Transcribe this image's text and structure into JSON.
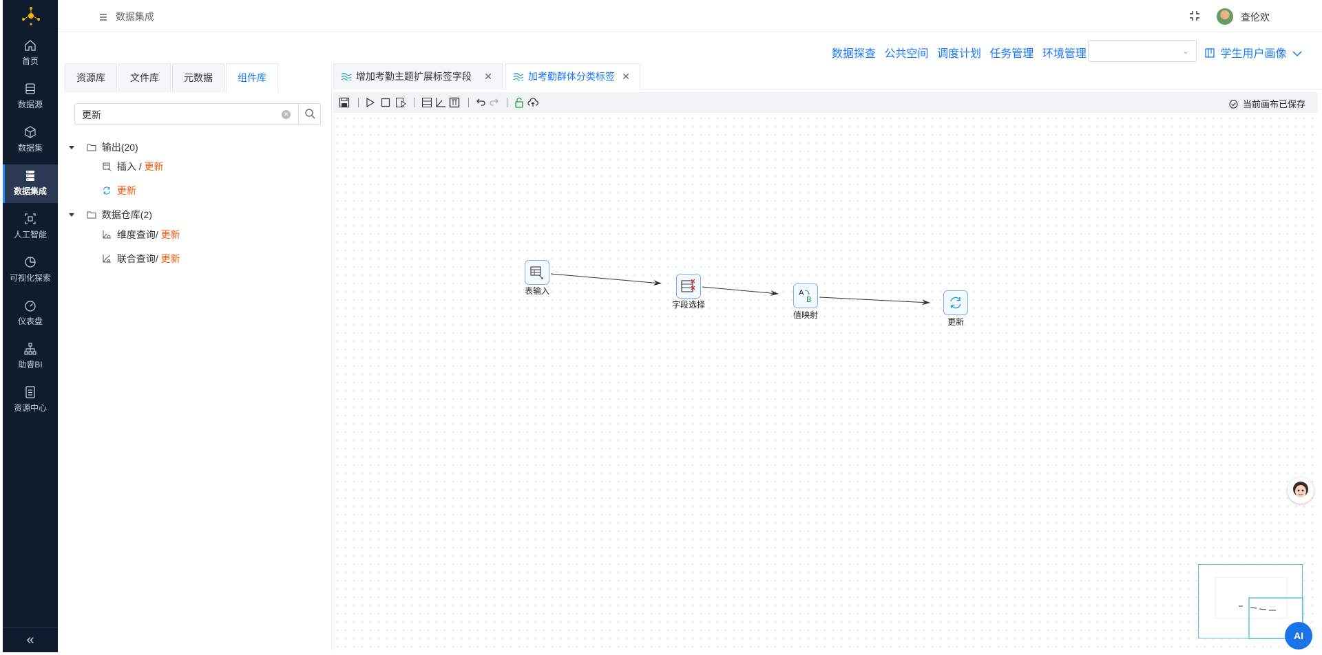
{
  "sidebar": {
    "items": [
      {
        "label": "首页",
        "icon": "home-icon"
      },
      {
        "label": "数据源",
        "icon": "database-icon"
      },
      {
        "label": "数据集",
        "icon": "cube-icon"
      },
      {
        "label": "数据集成",
        "icon": "server-icon",
        "active": true
      },
      {
        "label": "人工智能",
        "icon": "ai-scan-icon"
      },
      {
        "label": "可视化探索",
        "icon": "pie-chart-icon"
      },
      {
        "label": "仪表盘",
        "icon": "gauge-icon"
      },
      {
        "label": "助睿BI",
        "icon": "org-chart-icon"
      },
      {
        "label": "资源中心",
        "icon": "resource-icon"
      }
    ],
    "collapse_label": "«"
  },
  "header": {
    "breadcrumb": "数据集成",
    "username": "查伦欢"
  },
  "toplinks": [
    "数据探查",
    "公共空间",
    "调度计划",
    "任务管理",
    "环境管理"
  ],
  "env_select": {
    "value": ""
  },
  "project": {
    "name": "学生用户画像"
  },
  "left_panel": {
    "tabs": [
      {
        "label": "资源库"
      },
      {
        "label": "文件库"
      },
      {
        "label": "元数据"
      },
      {
        "label": "组件库",
        "active": true
      }
    ],
    "search": {
      "value": "更新"
    },
    "tree": {
      "group1": {
        "label": "输出(20)",
        "items": [
          {
            "prefix": "插入 / ",
            "highlight": "更新"
          },
          {
            "prefix": "",
            "highlight": "更新"
          }
        ]
      },
      "group2": {
        "label": "数据仓库(2)",
        "items": [
          {
            "prefix": "维度查询/ ",
            "highlight": "更新"
          },
          {
            "prefix": "联合查询/ ",
            "highlight": "更新"
          }
        ]
      }
    }
  },
  "canvas": {
    "tabs": [
      {
        "label": "增加考勤主题扩展标签字段"
      },
      {
        "label": "加考勤群体分类标签",
        "active": true
      }
    ],
    "status": "当前画布已保存",
    "nodes": [
      {
        "label": "表输入"
      },
      {
        "label": "字段选择"
      },
      {
        "label": "值映射"
      },
      {
        "label": "更新"
      }
    ]
  },
  "ai_button": {
    "label": "AI"
  },
  "colors": {
    "sidebar_bg": "#0f1c2e",
    "accent": "#1677ff",
    "highlight": "#f5580a"
  }
}
